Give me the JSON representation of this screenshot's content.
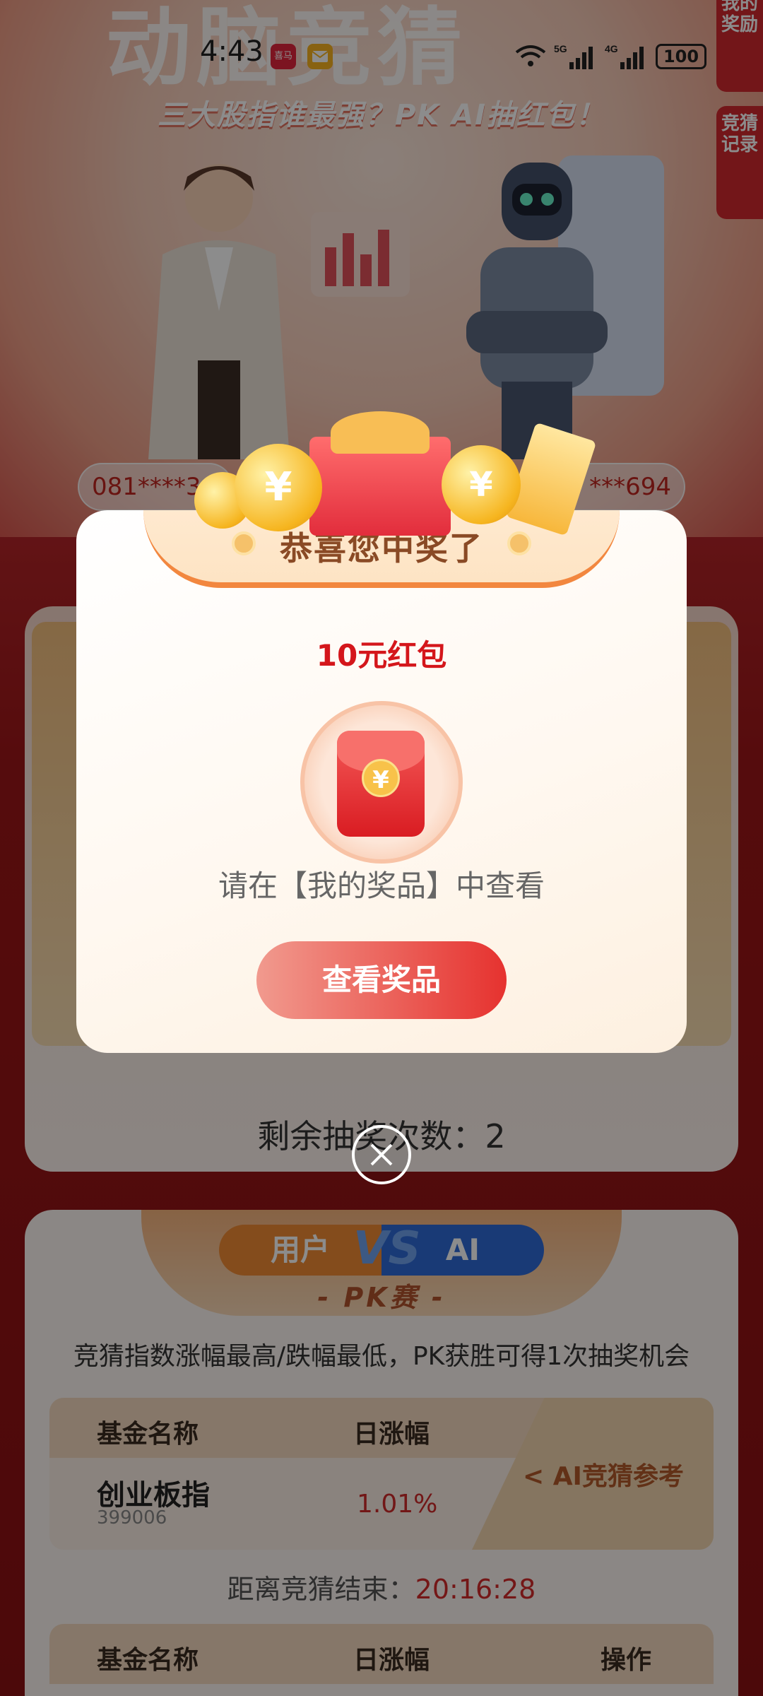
{
  "status_bar": {
    "time": "4:43",
    "notif_app_label": "喜马",
    "network": "5G 4G",
    "battery": "100"
  },
  "banner": {
    "headline": "动脑竞猜",
    "subtitle": "三大股指谁最强？PK AI抽红包！",
    "ticker_left": "081****3",
    "ticker_right": "***694"
  },
  "side_tabs": [
    "我的奖励",
    "竞猜记录"
  ],
  "draw_section": {
    "remaining_label": "剩余抽奖次数：",
    "remaining_count": "2"
  },
  "modal": {
    "title": "恭喜您中奖了",
    "prize": "10元红包",
    "envelope_symbol": "¥",
    "hint": "请在【我的奖品】中查看",
    "button": "查看奖品",
    "icons": [
      "red-envelope-icon",
      "close-icon",
      "gift-box-icon",
      "coin-icon"
    ]
  },
  "pk_section": {
    "user_label": "用户",
    "vs_label": "VS",
    "ai_label": "AI",
    "title": "- PK赛 -",
    "description": "竞猜指数涨幅最高/跌幅最低，PK获胜可得1次抽奖机会",
    "table": {
      "headers": [
        "基金名称",
        "日涨幅"
      ],
      "rows": [
        {
          "name": "创业板指",
          "code": "399006",
          "change": "1.01%"
        }
      ],
      "ai_ref": "< AI竞猜参考"
    },
    "countdown_label": "距离竞猜结束：",
    "countdown_value": "20:16:28",
    "table2_headers": [
      "基金名称",
      "日涨幅",
      "操作"
    ]
  },
  "colors": {
    "accent_red": "#d4161b",
    "button_gradient_start": "#f19a8e",
    "button_gradient_end": "#e6322f",
    "ai_blue": "#2f6bd8",
    "user_orange": "#f08a33"
  }
}
